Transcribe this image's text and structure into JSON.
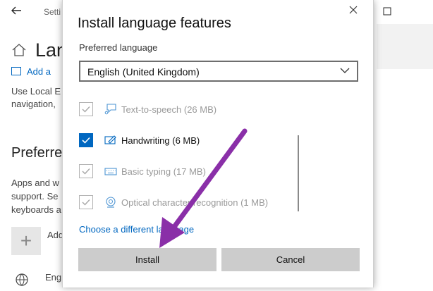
{
  "background": {
    "title": "Setti",
    "heading": "Lan",
    "add_language_link": "Add a",
    "text_line1": "Use Local E",
    "text_line2": "navigation,",
    "section_heading": "Preferre",
    "text_line3": "Apps and w",
    "text_line4": "support. Se",
    "text_line5": "keyboards a",
    "add_item_label": "Add",
    "english_label": "Eng"
  },
  "dialog": {
    "title": "Install language features",
    "preferred_label": "Preferred language",
    "selected_language": "English (United Kingdom)",
    "features": [
      {
        "label": "Text-to-speech (26 MB)",
        "checked": true,
        "enabled": false,
        "icon": "speech-icon"
      },
      {
        "label": "Handwriting (6 MB)",
        "checked": true,
        "enabled": true,
        "icon": "handwriting-icon"
      },
      {
        "label": "Basic typing (17 MB)",
        "checked": true,
        "enabled": false,
        "icon": "keyboard-icon"
      },
      {
        "label": "Optical character recognition (1 MB)",
        "checked": true,
        "enabled": false,
        "icon": "ocr-icon"
      }
    ],
    "choose_link": "Choose a different language",
    "install_label": "Install",
    "cancel_label": "Cancel"
  },
  "colors": {
    "accent": "#0067c0",
    "annotation_arrow": "#8a2fa8"
  }
}
